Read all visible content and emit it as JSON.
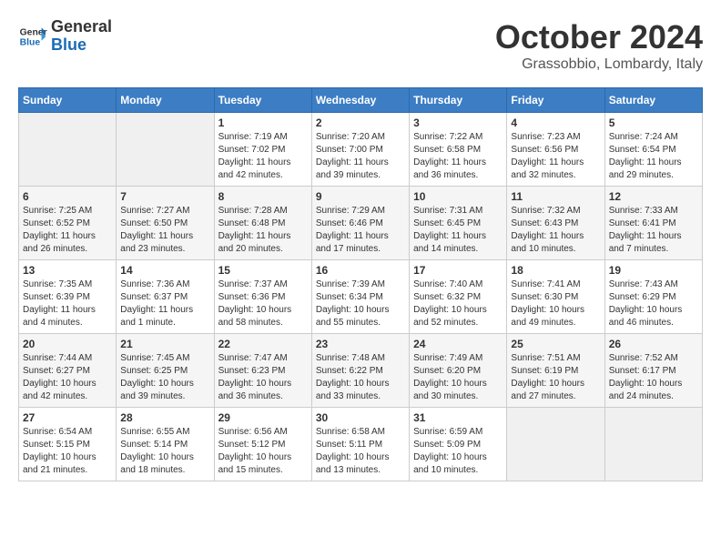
{
  "header": {
    "logo_line1": "General",
    "logo_line2": "Blue",
    "month": "October 2024",
    "location": "Grassobbio, Lombardy, Italy"
  },
  "days_of_week": [
    "Sunday",
    "Monday",
    "Tuesday",
    "Wednesday",
    "Thursday",
    "Friday",
    "Saturday"
  ],
  "weeks": [
    [
      {
        "day": "",
        "info": ""
      },
      {
        "day": "",
        "info": ""
      },
      {
        "day": "1",
        "info": "Sunrise: 7:19 AM\nSunset: 7:02 PM\nDaylight: 11 hours and 42 minutes."
      },
      {
        "day": "2",
        "info": "Sunrise: 7:20 AM\nSunset: 7:00 PM\nDaylight: 11 hours and 39 minutes."
      },
      {
        "day": "3",
        "info": "Sunrise: 7:22 AM\nSunset: 6:58 PM\nDaylight: 11 hours and 36 minutes."
      },
      {
        "day": "4",
        "info": "Sunrise: 7:23 AM\nSunset: 6:56 PM\nDaylight: 11 hours and 32 minutes."
      },
      {
        "day": "5",
        "info": "Sunrise: 7:24 AM\nSunset: 6:54 PM\nDaylight: 11 hours and 29 minutes."
      }
    ],
    [
      {
        "day": "6",
        "info": "Sunrise: 7:25 AM\nSunset: 6:52 PM\nDaylight: 11 hours and 26 minutes."
      },
      {
        "day": "7",
        "info": "Sunrise: 7:27 AM\nSunset: 6:50 PM\nDaylight: 11 hours and 23 minutes."
      },
      {
        "day": "8",
        "info": "Sunrise: 7:28 AM\nSunset: 6:48 PM\nDaylight: 11 hours and 20 minutes."
      },
      {
        "day": "9",
        "info": "Sunrise: 7:29 AM\nSunset: 6:46 PM\nDaylight: 11 hours and 17 minutes."
      },
      {
        "day": "10",
        "info": "Sunrise: 7:31 AM\nSunset: 6:45 PM\nDaylight: 11 hours and 14 minutes."
      },
      {
        "day": "11",
        "info": "Sunrise: 7:32 AM\nSunset: 6:43 PM\nDaylight: 11 hours and 10 minutes."
      },
      {
        "day": "12",
        "info": "Sunrise: 7:33 AM\nSunset: 6:41 PM\nDaylight: 11 hours and 7 minutes."
      }
    ],
    [
      {
        "day": "13",
        "info": "Sunrise: 7:35 AM\nSunset: 6:39 PM\nDaylight: 11 hours and 4 minutes."
      },
      {
        "day": "14",
        "info": "Sunrise: 7:36 AM\nSunset: 6:37 PM\nDaylight: 11 hours and 1 minute."
      },
      {
        "day": "15",
        "info": "Sunrise: 7:37 AM\nSunset: 6:36 PM\nDaylight: 10 hours and 58 minutes."
      },
      {
        "day": "16",
        "info": "Sunrise: 7:39 AM\nSunset: 6:34 PM\nDaylight: 10 hours and 55 minutes."
      },
      {
        "day": "17",
        "info": "Sunrise: 7:40 AM\nSunset: 6:32 PM\nDaylight: 10 hours and 52 minutes."
      },
      {
        "day": "18",
        "info": "Sunrise: 7:41 AM\nSunset: 6:30 PM\nDaylight: 10 hours and 49 minutes."
      },
      {
        "day": "19",
        "info": "Sunrise: 7:43 AM\nSunset: 6:29 PM\nDaylight: 10 hours and 46 minutes."
      }
    ],
    [
      {
        "day": "20",
        "info": "Sunrise: 7:44 AM\nSunset: 6:27 PM\nDaylight: 10 hours and 42 minutes."
      },
      {
        "day": "21",
        "info": "Sunrise: 7:45 AM\nSunset: 6:25 PM\nDaylight: 10 hours and 39 minutes."
      },
      {
        "day": "22",
        "info": "Sunrise: 7:47 AM\nSunset: 6:23 PM\nDaylight: 10 hours and 36 minutes."
      },
      {
        "day": "23",
        "info": "Sunrise: 7:48 AM\nSunset: 6:22 PM\nDaylight: 10 hours and 33 minutes."
      },
      {
        "day": "24",
        "info": "Sunrise: 7:49 AM\nSunset: 6:20 PM\nDaylight: 10 hours and 30 minutes."
      },
      {
        "day": "25",
        "info": "Sunrise: 7:51 AM\nSunset: 6:19 PM\nDaylight: 10 hours and 27 minutes."
      },
      {
        "day": "26",
        "info": "Sunrise: 7:52 AM\nSunset: 6:17 PM\nDaylight: 10 hours and 24 minutes."
      }
    ],
    [
      {
        "day": "27",
        "info": "Sunrise: 6:54 AM\nSunset: 5:15 PM\nDaylight: 10 hours and 21 minutes."
      },
      {
        "day": "28",
        "info": "Sunrise: 6:55 AM\nSunset: 5:14 PM\nDaylight: 10 hours and 18 minutes."
      },
      {
        "day": "29",
        "info": "Sunrise: 6:56 AM\nSunset: 5:12 PM\nDaylight: 10 hours and 15 minutes."
      },
      {
        "day": "30",
        "info": "Sunrise: 6:58 AM\nSunset: 5:11 PM\nDaylight: 10 hours and 13 minutes."
      },
      {
        "day": "31",
        "info": "Sunrise: 6:59 AM\nSunset: 5:09 PM\nDaylight: 10 hours and 10 minutes."
      },
      {
        "day": "",
        "info": ""
      },
      {
        "day": "",
        "info": ""
      }
    ]
  ]
}
